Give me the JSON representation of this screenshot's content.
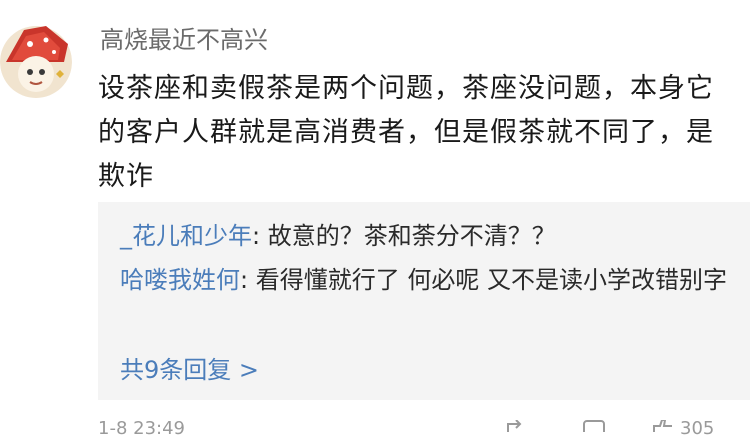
{
  "comment": {
    "username": "高烧最近不高兴",
    "text": "设茶座和卖假茶是两个问题，茶座没问题，本身它的客户人群就是高消费者，但是假茶就不同了，是欺诈"
  },
  "replies": [
    {
      "author": "_花儿和少年",
      "separator": ": ",
      "text": "故意的？茶和荼分不清？？"
    },
    {
      "author": "哈喽我姓何",
      "separator": ": ",
      "text": "看得懂就行了 何必呢 又不是读小学改错别字"
    }
  ],
  "more_replies": "共9条回复 >",
  "footer": {
    "timestamp": "1-8 23:49",
    "like_count": "305"
  }
}
